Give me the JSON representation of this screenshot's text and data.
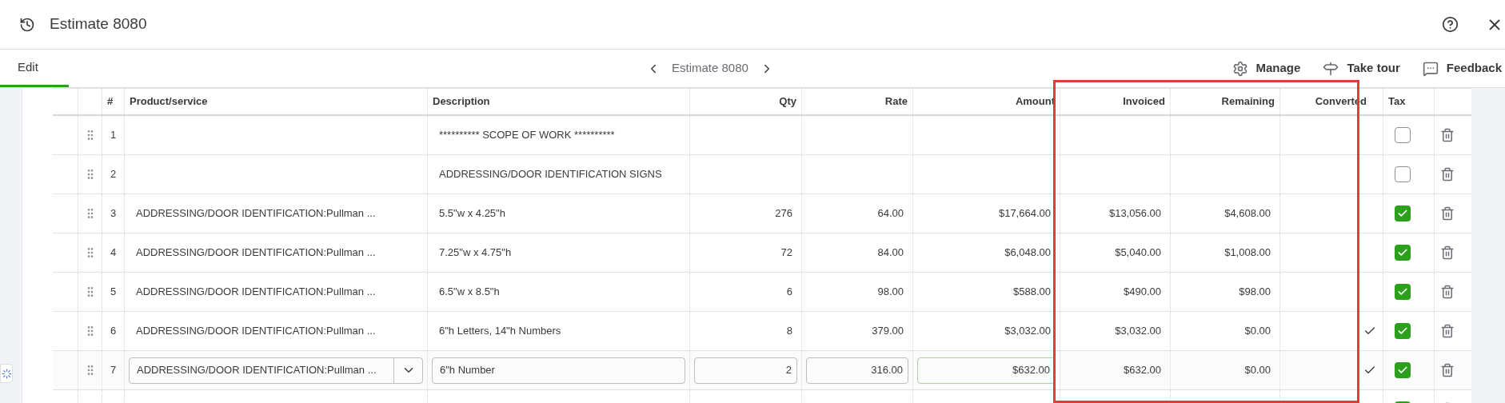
{
  "header": {
    "title": "Estimate 8080"
  },
  "tabs": [
    {
      "label": "Edit",
      "selected": true
    }
  ],
  "nav": {
    "label": "Estimate 8080"
  },
  "toolbar": [
    {
      "label": "Manage",
      "kind": "gear"
    },
    {
      "label": "Take tour",
      "kind": "tour"
    },
    {
      "label": "Feedback",
      "kind": "feedback"
    }
  ],
  "table": {
    "columns": [
      "#",
      "Product/service",
      "Description",
      "Qty",
      "Rate",
      "Amount",
      "Invoiced",
      "Remaining",
      "Converted",
      "Tax"
    ],
    "rows": [
      {
        "number": "1",
        "description": "********** SCOPE OF WORK **********",
        "converted": false,
        "tax": false,
        "editing": false
      },
      {
        "number": "2",
        "description": "ADDRESSING/DOOR IDENTIFICATION SIGNS",
        "converted": false,
        "tax": false,
        "editing": false
      },
      {
        "number": "3",
        "product": "ADDRESSING/DOOR IDENTIFICATION:Pullman ...",
        "description": "5.5\"w x 4.25\"h",
        "qty": "276",
        "rate": "64.00",
        "amount": "$17,664.00",
        "invoiced": "$13,056.00",
        "remaining": "$4,608.00",
        "converted": false,
        "tax": true,
        "editing": false
      },
      {
        "number": "4",
        "product": "ADDRESSING/DOOR IDENTIFICATION:Pullman ...",
        "description": "7.25\"w x 4.75\"h",
        "qty": "72",
        "rate": "84.00",
        "amount": "$6,048.00",
        "invoiced": "$5,040.00",
        "remaining": "$1,008.00",
        "converted": false,
        "tax": true,
        "editing": false
      },
      {
        "number": "5",
        "product": "ADDRESSING/DOOR IDENTIFICATION:Pullman ...",
        "description": "6.5\"w x 8.5\"h",
        "qty": "6",
        "rate": "98.00",
        "amount": "$588.00",
        "invoiced": "$490.00",
        "remaining": "$98.00",
        "converted": false,
        "tax": true,
        "editing": false
      },
      {
        "number": "6",
        "product": "ADDRESSING/DOOR IDENTIFICATION:Pullman ...",
        "description": "6\"h Letters, 14\"h Numbers",
        "qty": "8",
        "rate": "379.00",
        "amount": "$3,032.00",
        "invoiced": "$3,032.00",
        "remaining": "$0.00",
        "converted": true,
        "tax": true,
        "editing": false
      },
      {
        "number": "7",
        "product": "ADDRESSING/DOOR IDENTIFICATION:Pullman ...",
        "description": "6\"h Number",
        "qty": "2",
        "rate": "316.00",
        "amount": "$632.00",
        "invoiced": "$632.00",
        "remaining": "$0.00",
        "converted": true,
        "tax": true,
        "editing": true
      },
      {
        "converted": false,
        "tax": true,
        "editing": false
      }
    ]
  },
  "annotation": {
    "kind": "highlight-frame"
  }
}
